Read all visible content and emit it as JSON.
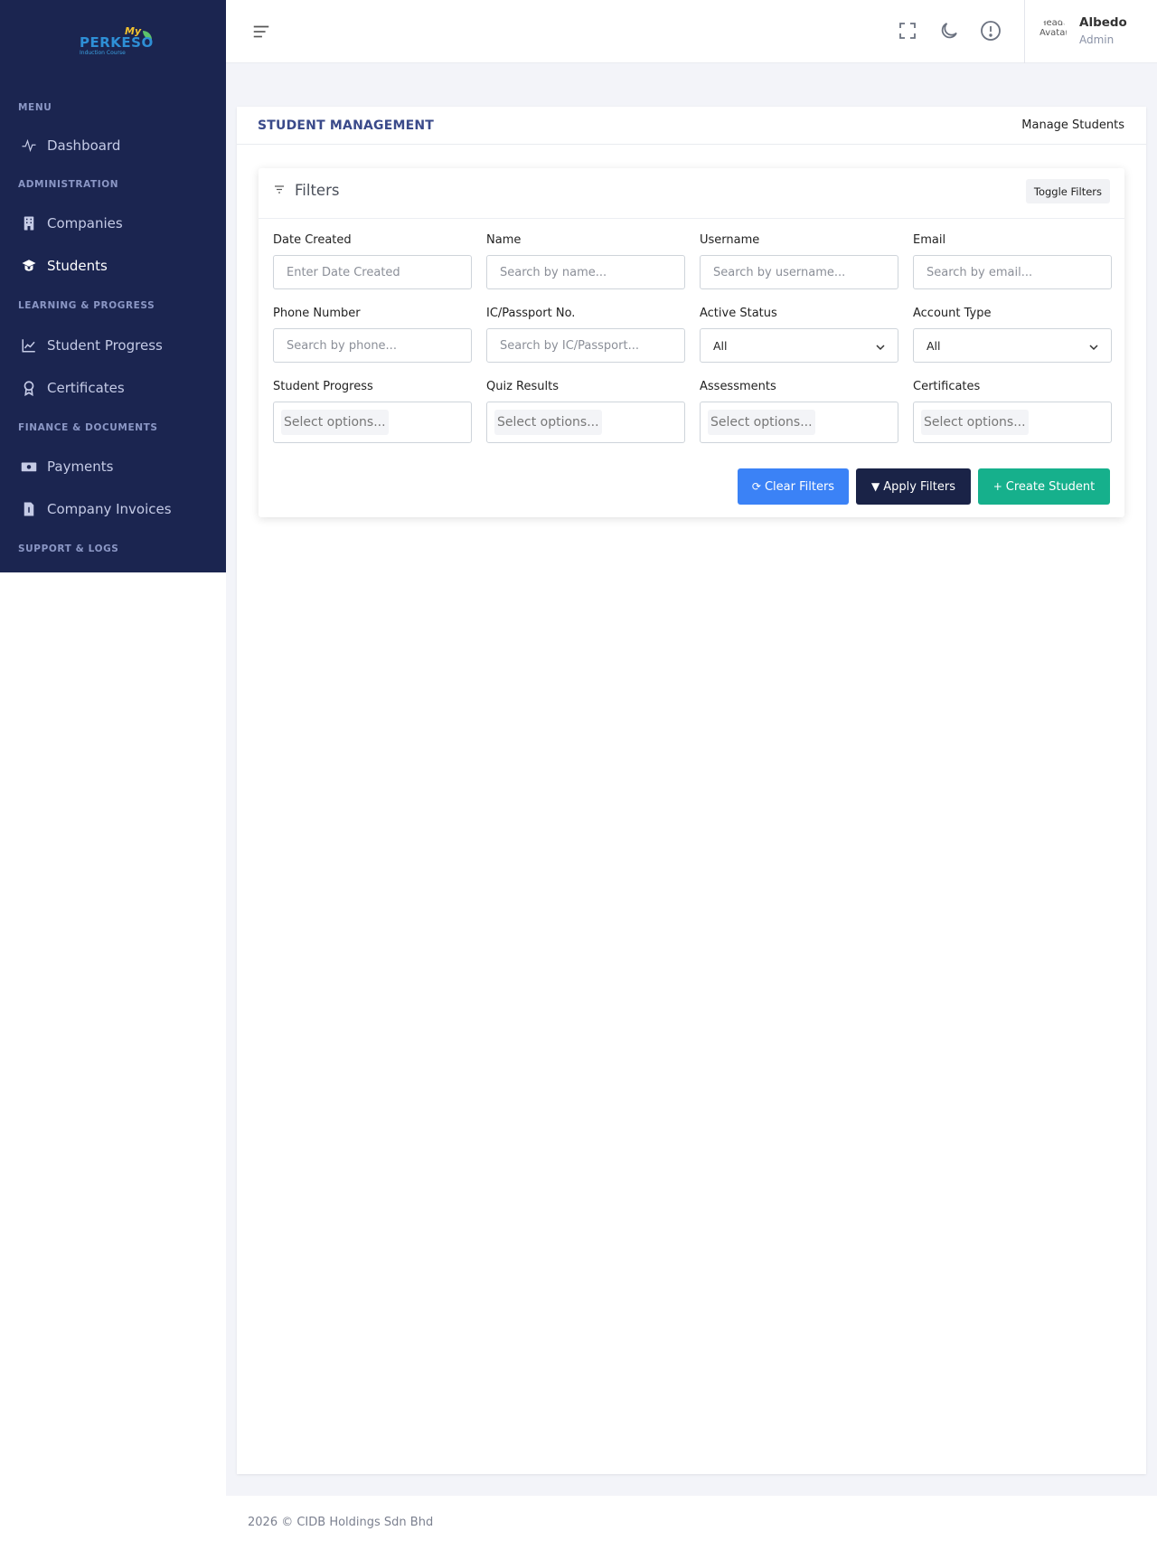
{
  "brand": {
    "my": "My",
    "name": "PERKESO",
    "tagline": "Induction Course"
  },
  "sidebar": {
    "sections": [
      {
        "title": "MENU"
      },
      {
        "title": "ADMINISTRATION"
      },
      {
        "title": "LEARNING & PROGRESS"
      },
      {
        "title": "FINANCE & DOCUMENTS"
      },
      {
        "title": "SUPPORT & LOGS"
      }
    ],
    "items": [
      {
        "label": "Dashboard",
        "icon": "activity-icon"
      },
      {
        "label": "Companies",
        "icon": "building-icon"
      },
      {
        "label": "Students",
        "icon": "graduation-cap-icon",
        "active": true
      },
      {
        "label": "Student Progress",
        "icon": "line-chart-icon"
      },
      {
        "label": "Certificates",
        "icon": "award-icon"
      },
      {
        "label": "Payments",
        "icon": "money-icon"
      },
      {
        "label": "Company Invoices",
        "icon": "invoice-icon"
      }
    ]
  },
  "topbar": {
    "avatar_alt": "Header Avatar",
    "user_name": "Albedo",
    "user_role": "Admin"
  },
  "page": {
    "title": "STUDENT MANAGEMENT",
    "subtitle": "Manage Students"
  },
  "filters": {
    "title": "Filters",
    "toggle_label": "Toggle Filters",
    "date_created": {
      "label": "Date Created",
      "placeholder": "Enter Date Created"
    },
    "name": {
      "label": "Name",
      "placeholder": "Search by name..."
    },
    "username": {
      "label": "Username",
      "placeholder": "Search by username..."
    },
    "email": {
      "label": "Email",
      "placeholder": "Search by email..."
    },
    "phone": {
      "label": "Phone Number",
      "placeholder": "Search by phone..."
    },
    "ic_passport": {
      "label": "IC/Passport No.",
      "placeholder": "Search by IC/Passport..."
    },
    "active_status": {
      "label": "Active Status",
      "value": "All"
    },
    "account_type": {
      "label": "Account Type",
      "value": "All"
    },
    "student_progress": {
      "label": "Student Progress",
      "placeholder": "Select options..."
    },
    "quiz_results": {
      "label": "Quiz Results",
      "placeholder": "Select options..."
    },
    "assessments": {
      "label": "Assessments",
      "placeholder": "Select options..."
    },
    "certificates": {
      "label": "Certificates",
      "placeholder": "Select options..."
    },
    "buttons": {
      "clear": "Clear Filters",
      "apply": "Apply Filters",
      "create": "Create Student"
    }
  },
  "footer": {
    "text": "2026 © CIDB Holdings Sdn Bhd"
  },
  "colors": {
    "sidebar_bg": "#1b2550",
    "accent_title": "#3a4a8a",
    "clear_btn": "#3b82f6",
    "apply_btn": "#1a2347",
    "create_btn": "#16b08c"
  }
}
